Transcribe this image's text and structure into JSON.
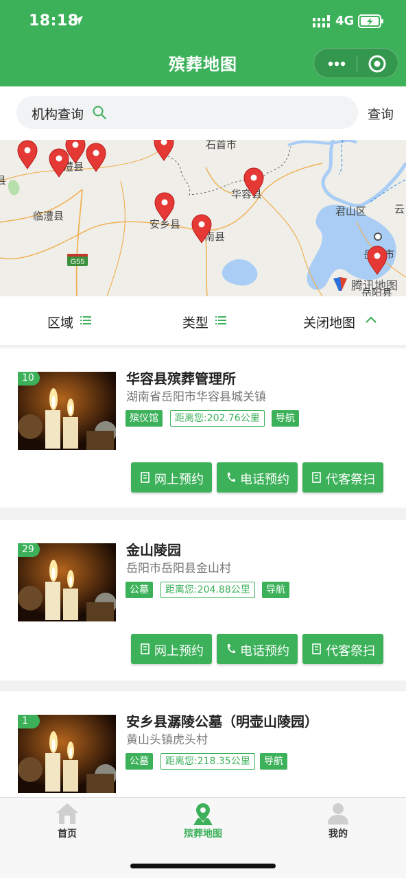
{
  "status_bar": {
    "time": "18:18",
    "network": "4G"
  },
  "header": {
    "title": "殡葬地图"
  },
  "search": {
    "label": "机构查询",
    "button": "查询"
  },
  "map": {
    "labels": [
      "石首市",
      "澧县",
      "华容县",
      "君山区",
      "云",
      "临澧县",
      "安乡县",
      "南县",
      "岳阳市",
      "岳阳县",
      "G55",
      "县"
    ],
    "attribution": "腾讯地图"
  },
  "filters": {
    "area": "区域",
    "type": "类型",
    "close_map": "关闭地图"
  },
  "cards": [
    {
      "rank": "10",
      "name": "华容县殡葬管理所",
      "address": "湖南省岳阳市华容县城关镇",
      "type_tag": "殡仪馆",
      "distance": "距离您:202.76公里",
      "nav": "导航",
      "actions": [
        "网上预约",
        "电话预约",
        "代客祭扫"
      ]
    },
    {
      "rank": "29",
      "name": "金山陵园",
      "address": "岳阳市岳阳县金山村",
      "type_tag": "公墓",
      "distance": "距离您:204.88公里",
      "nav": "导航",
      "actions": [
        "网上预约",
        "电话预约",
        "代客祭扫"
      ]
    },
    {
      "rank": "1",
      "name": "安乡县潺陵公墓（明壶山陵园）",
      "address": "黄山头镇虎头村",
      "type_tag": "公墓",
      "distance": "距离您:218.35公里",
      "nav": "导航",
      "actions": []
    }
  ],
  "tabbar": {
    "items": [
      {
        "label": "首页",
        "icon": "home-icon"
      },
      {
        "label": "殡葬地图",
        "icon": "map-pin-icon"
      },
      {
        "label": "我的",
        "icon": "user-icon"
      }
    ],
    "active": "殡葬地图"
  },
  "colors": {
    "brand_green": "#3cb15a",
    "pin_red": "#e53935",
    "water_blue": "#a9cdf4"
  }
}
